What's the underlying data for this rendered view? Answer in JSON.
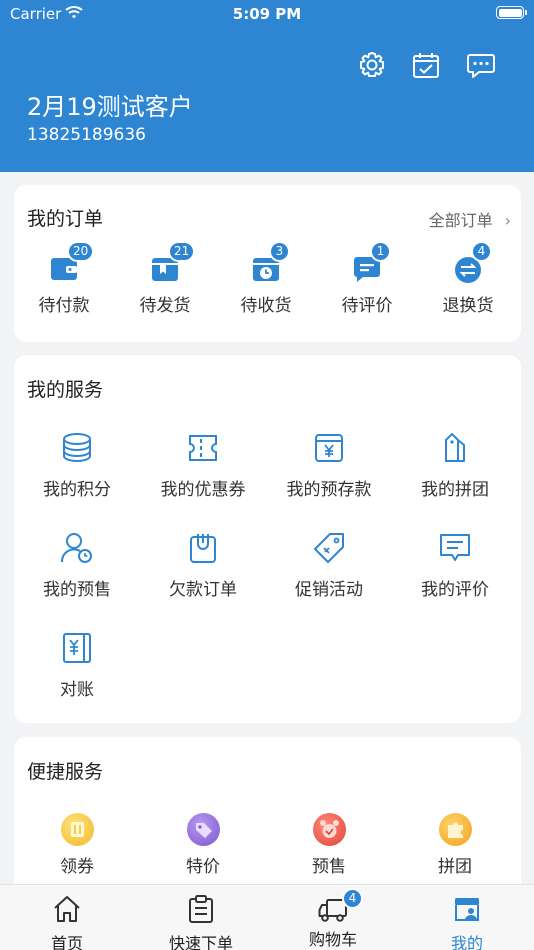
{
  "status_bar": {
    "carrier": "Carrier",
    "time": "5:09 PM"
  },
  "header": {
    "username": "2月19测试客户",
    "phone": "13825189636",
    "icons": [
      "gear-icon",
      "calendar-check-icon",
      "message-icon"
    ]
  },
  "orders": {
    "title": "我的订单",
    "all_label": "全部订单",
    "items": [
      {
        "label": "待付款",
        "badge": "20",
        "icon": "wallet-icon"
      },
      {
        "label": "待发货",
        "badge": "21",
        "icon": "box-icon"
      },
      {
        "label": "待收货",
        "badge": "3",
        "icon": "delivery-clock-icon"
      },
      {
        "label": "待评价",
        "badge": "1",
        "icon": "comment-icon"
      },
      {
        "label": "退换货",
        "badge": "4",
        "icon": "exchange-icon"
      }
    ]
  },
  "services": {
    "title": "我的服务",
    "items": [
      {
        "label": "我的积分",
        "icon": "coins-icon"
      },
      {
        "label": "我的优惠券",
        "icon": "coupon-icon"
      },
      {
        "label": "我的预存款",
        "icon": "deposit-icon"
      },
      {
        "label": "我的拼团",
        "icon": "group-tag-icon"
      },
      {
        "label": "我的预售",
        "icon": "user-clock-icon"
      },
      {
        "label": "欠款订单",
        "icon": "clipboard-icon"
      },
      {
        "label": "促销活动",
        "icon": "price-tag-icon"
      },
      {
        "label": "我的评价",
        "icon": "review-icon"
      },
      {
        "label": "对账",
        "icon": "ledger-icon"
      }
    ]
  },
  "quick": {
    "title": "便捷服务",
    "items": [
      {
        "label": "领券",
        "icon": "coupon-circle-icon",
        "color": "#f7c948"
      },
      {
        "label": "特价",
        "icon": "special-price-icon",
        "color": "#8e6bd8"
      },
      {
        "label": "预售",
        "icon": "presale-icon",
        "color": "#e85a4f"
      },
      {
        "label": "拼团",
        "icon": "puzzle-icon",
        "color": "#f5a623"
      }
    ]
  },
  "tabbar": {
    "items": [
      {
        "label": "首页",
        "icon": "home-icon"
      },
      {
        "label": "快速下单",
        "icon": "clipboard-list-icon"
      },
      {
        "label": "购物车",
        "icon": "truck-icon",
        "badge": "4"
      },
      {
        "label": "我的",
        "icon": "store-user-icon",
        "active": true
      }
    ]
  },
  "colors": {
    "brand": "#2e86d3",
    "background": "#f2f3f5"
  }
}
